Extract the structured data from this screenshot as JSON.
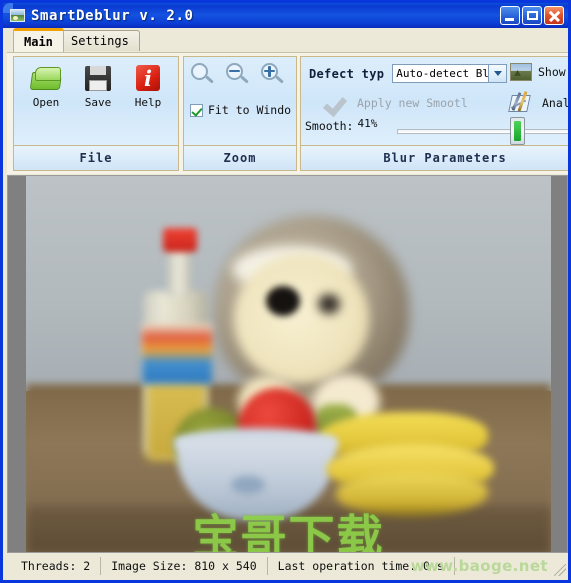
{
  "window": {
    "title": "SmartDeblur v. 2.0",
    "icon": "app-image-icon",
    "controls": {
      "minimize": "minimize-button",
      "maximize": "maximize-button",
      "close": "close-button"
    }
  },
  "tabs": [
    {
      "label": "Main",
      "active": true
    },
    {
      "label": "Settings",
      "active": false
    }
  ],
  "toolbar": {
    "file": {
      "caption": "File",
      "buttons": [
        {
          "label": "Open",
          "icon": "open-folder-icon"
        },
        {
          "label": "Save",
          "icon": "floppy-disk-icon"
        },
        {
          "label": "Help",
          "icon": "info-icon"
        }
      ]
    },
    "zoom": {
      "caption": "Zoom",
      "buttons": [
        {
          "icon": "magnifier-icon"
        },
        {
          "icon": "zoom-out-icon"
        },
        {
          "icon": "zoom-in-icon"
        }
      ],
      "fit_to_window": {
        "label": "Fit to Windo",
        "checked": true
      }
    },
    "blur": {
      "caption": "Blur Parameters",
      "defect_type_label": "Defect typ",
      "defect_type_value": "Auto-detect Blu",
      "show_original_label": "Show C",
      "show_original_icon": "image-thumbnail-icon",
      "apply_label": "Apply new Smootl",
      "apply_enabled": false,
      "analyze_label": "Analy",
      "analyze_icon": "analyze-icon",
      "smooth_label": "Smooth:",
      "smooth_value": "41%",
      "smooth_percent": 41
    }
  },
  "image": {
    "alt": "blurred photo of plush hedgehog with juice bottle, bowl of apples and bananas on a table",
    "watermark_cn": "宝哥下载",
    "watermark_url": "www.baoge.net"
  },
  "statusbar": {
    "threads": "Threads: 2",
    "image_size": "Image Size: 810 x 540",
    "last_operation": "Last operation time: 0 s"
  }
}
